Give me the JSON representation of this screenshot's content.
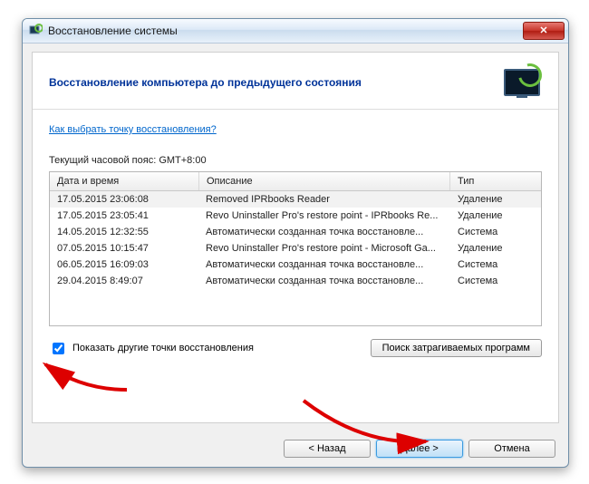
{
  "window": {
    "title": "Восстановление системы"
  },
  "header": {
    "heading": "Восстановление компьютера до предыдущего состояния"
  },
  "body": {
    "help_link": "Как выбрать точку восстановления?",
    "timezone_label": "Текущий часовой пояс: GMT+8:00",
    "columns": {
      "c1": "Дата и время",
      "c2": "Описание",
      "c3": "Тип"
    },
    "rows": [
      {
        "dt": "17.05.2015 23:06:08",
        "desc": "Removed IPRbooks Reader",
        "type": "Удаление"
      },
      {
        "dt": "17.05.2015 23:05:41",
        "desc": "Revo Uninstaller Pro's restore point - IPRbooks Re...",
        "type": "Удаление"
      },
      {
        "dt": "14.05.2015 12:32:55",
        "desc": "Автоматически созданная точка восстановле...",
        "type": "Система"
      },
      {
        "dt": "07.05.2015 10:15:47",
        "desc": "Revo Uninstaller Pro's restore point - Microsoft Ga...",
        "type": "Удаление"
      },
      {
        "dt": "06.05.2015 16:09:03",
        "desc": "Автоматически созданная точка восстановле...",
        "type": "Система"
      },
      {
        "dt": "29.04.2015 8:49:07",
        "desc": "Автоматически созданная точка восстановле...",
        "type": "Система"
      }
    ],
    "show_more_label": "Показать другие точки восстановления",
    "affected_programs_btn": "Поиск затрагиваемых программ"
  },
  "footer": {
    "back": "< Назад",
    "next": "Далее >",
    "cancel": "Отмена"
  }
}
